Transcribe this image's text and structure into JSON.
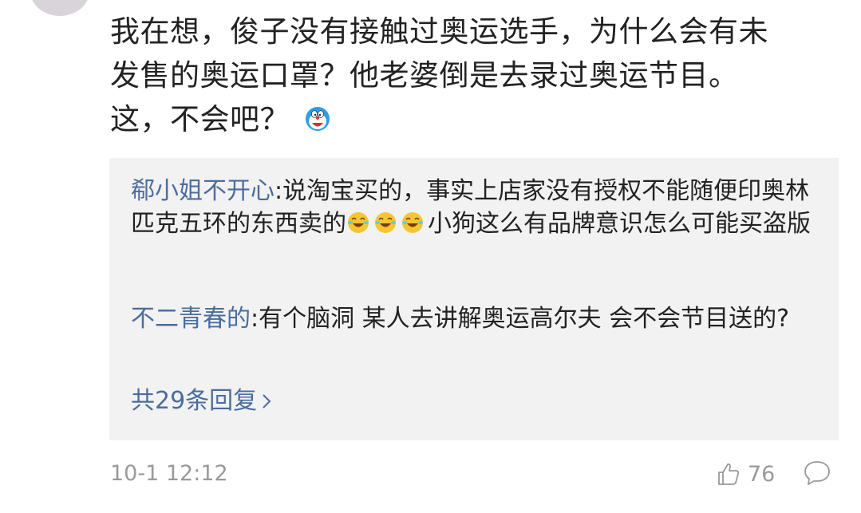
{
  "comment": {
    "text_line_1": "我在想，俊子没有接触过奥运选手，为什么会有未",
    "text_line_2": "发售的奥运口罩？他老婆倒是去录过奥运节目。",
    "text_line_3": "这，不会吧？",
    "emoji": "doraemon-emoji"
  },
  "replies": [
    {
      "author": "郗小姐不开心",
      "separator": ":",
      "text_before_emoji": "说淘宝买的，事实上店家没有授权不能随便印奥林匹克五环的东西卖的",
      "emoji": "laughing-tears-emoji",
      "text_after_emoji": "小狗这么有品牌意识怎么可能买盗版"
    },
    {
      "author": "不二青春的",
      "separator": ":",
      "text": "有个脑洞 某人去讲解奥运高尔夫 会不会节目送的?"
    }
  ],
  "more_replies_label": "共29条回复",
  "footer": {
    "timestamp": "10-1 12:12",
    "like_count": "76",
    "like_icon": "thumbs-up-icon",
    "comment_icon": "comment-bubble-icon"
  },
  "colors": {
    "author_link": "#4a6d9e",
    "reply_background": "#f2f2f2",
    "meta_text": "#9a9a9a",
    "body_text": "#222222"
  }
}
